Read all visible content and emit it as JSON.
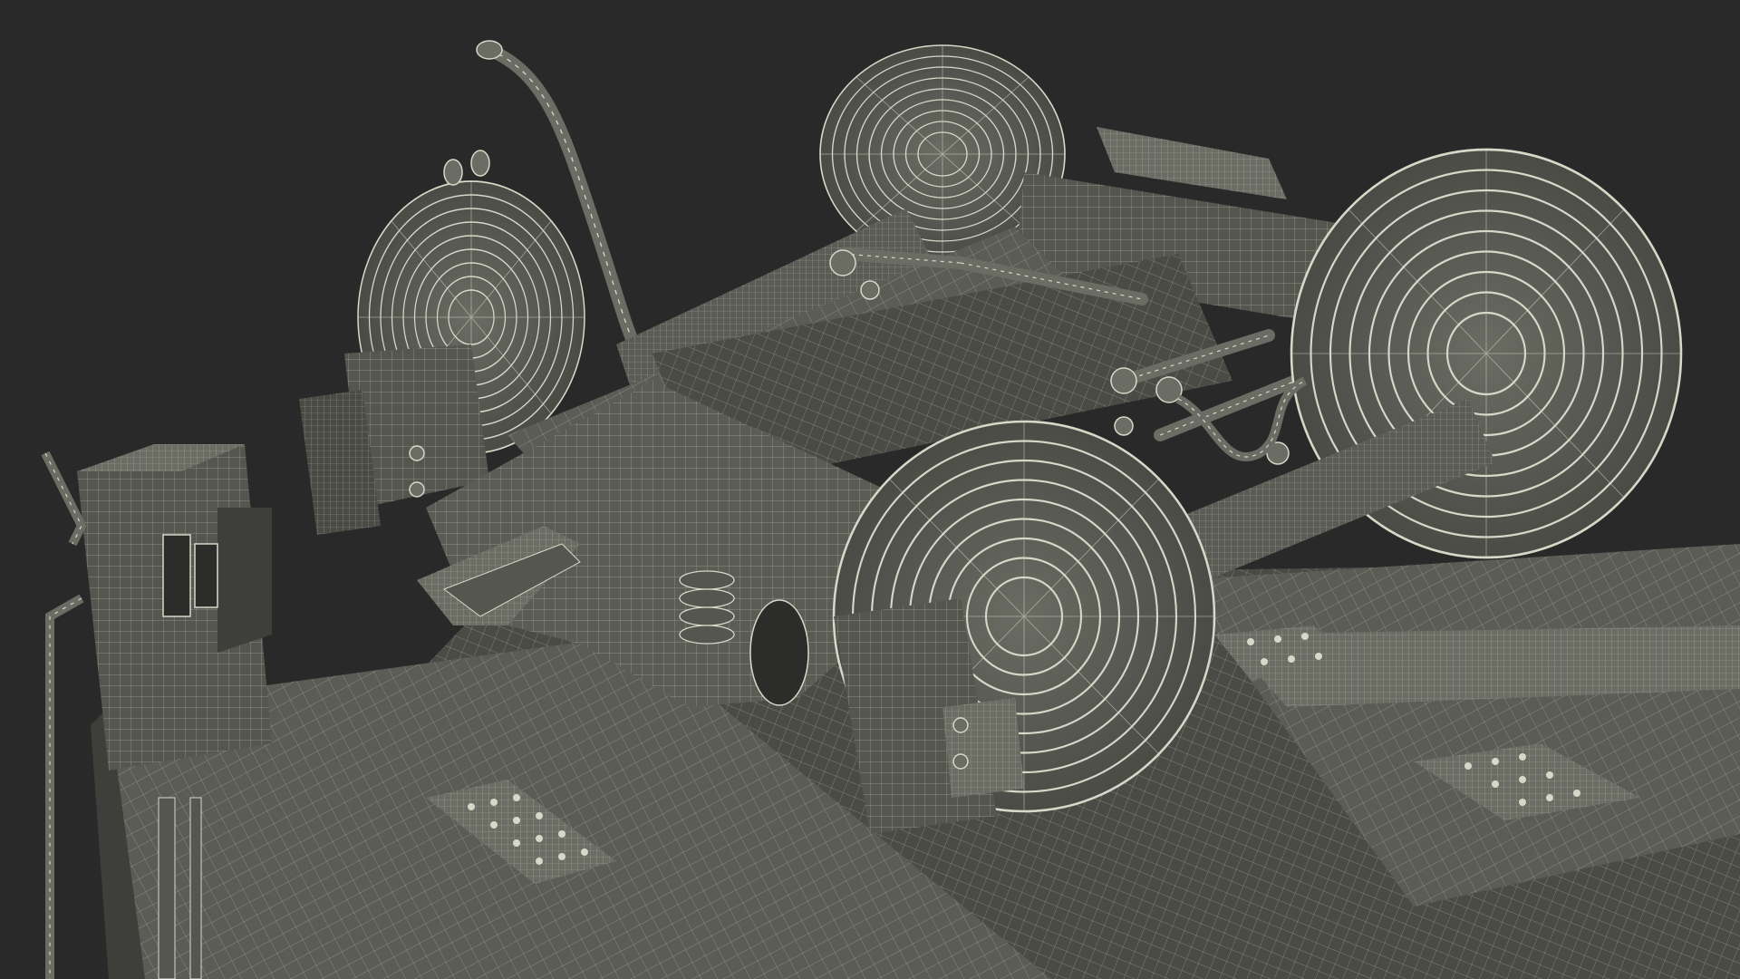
{
  "scene": {
    "background_color": "#292929",
    "model_fill": "#55564f",
    "model_fill_dark": "#3e3f3a",
    "model_fill_light": "#6b6c64",
    "wire_color": "#d8d8c8",
    "render_style": "wireframe-on-shaded"
  }
}
